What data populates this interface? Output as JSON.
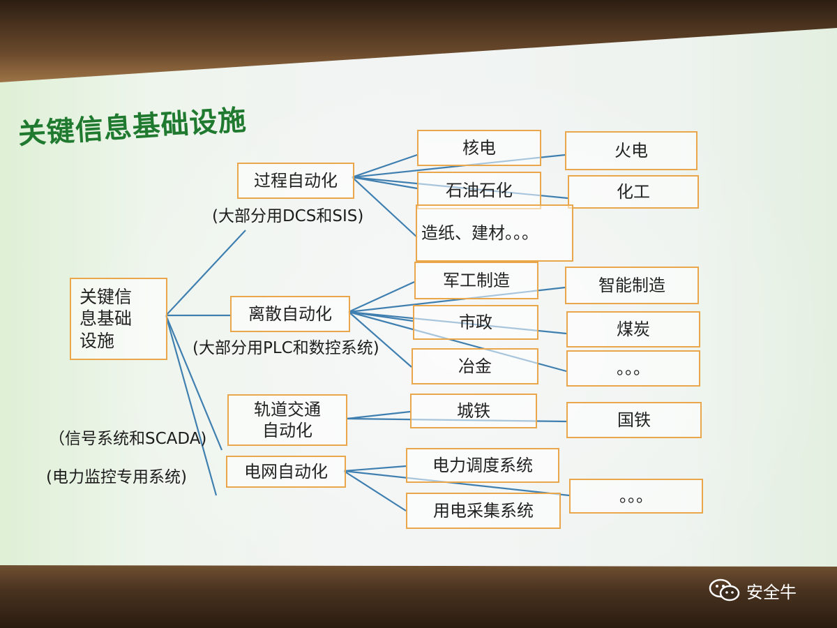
{
  "title": "关键信息基础设施",
  "root": "关键信\n息基础\n设施",
  "categories": [
    {
      "id": "process",
      "label": "过程自动化",
      "note": "(大部分用DCS和SIS)"
    },
    {
      "id": "discrete",
      "label": "离散自动化",
      "note": "(大部分用PLC和数控系统)"
    },
    {
      "id": "rail",
      "label": "轨道交通\n自动化",
      "note": "（信号系统和SCADA)"
    },
    {
      "id": "grid",
      "label": "电网自动化",
      "note": "(电力监控专用系统)"
    }
  ],
  "leaves": {
    "nuclear": "核电",
    "thermal": "火电",
    "petro": "石油石化",
    "chemical": "化工",
    "paper": "造纸、建材。。。",
    "military": "军工制造",
    "smart": "智能制造",
    "municipal": "市政",
    "coal": "煤炭",
    "metallurgy": "冶金",
    "etc1": "。。。",
    "metro": "城铁",
    "national_rail": "国铁",
    "dispatch": "电力调度系统",
    "etc2": "。。。",
    "metering": "用电采集系统"
  },
  "watermark": "安全牛",
  "colors": {
    "title": "#1f7a2f",
    "box_border": "#e9a64a",
    "connector": "#3f7fb0"
  }
}
